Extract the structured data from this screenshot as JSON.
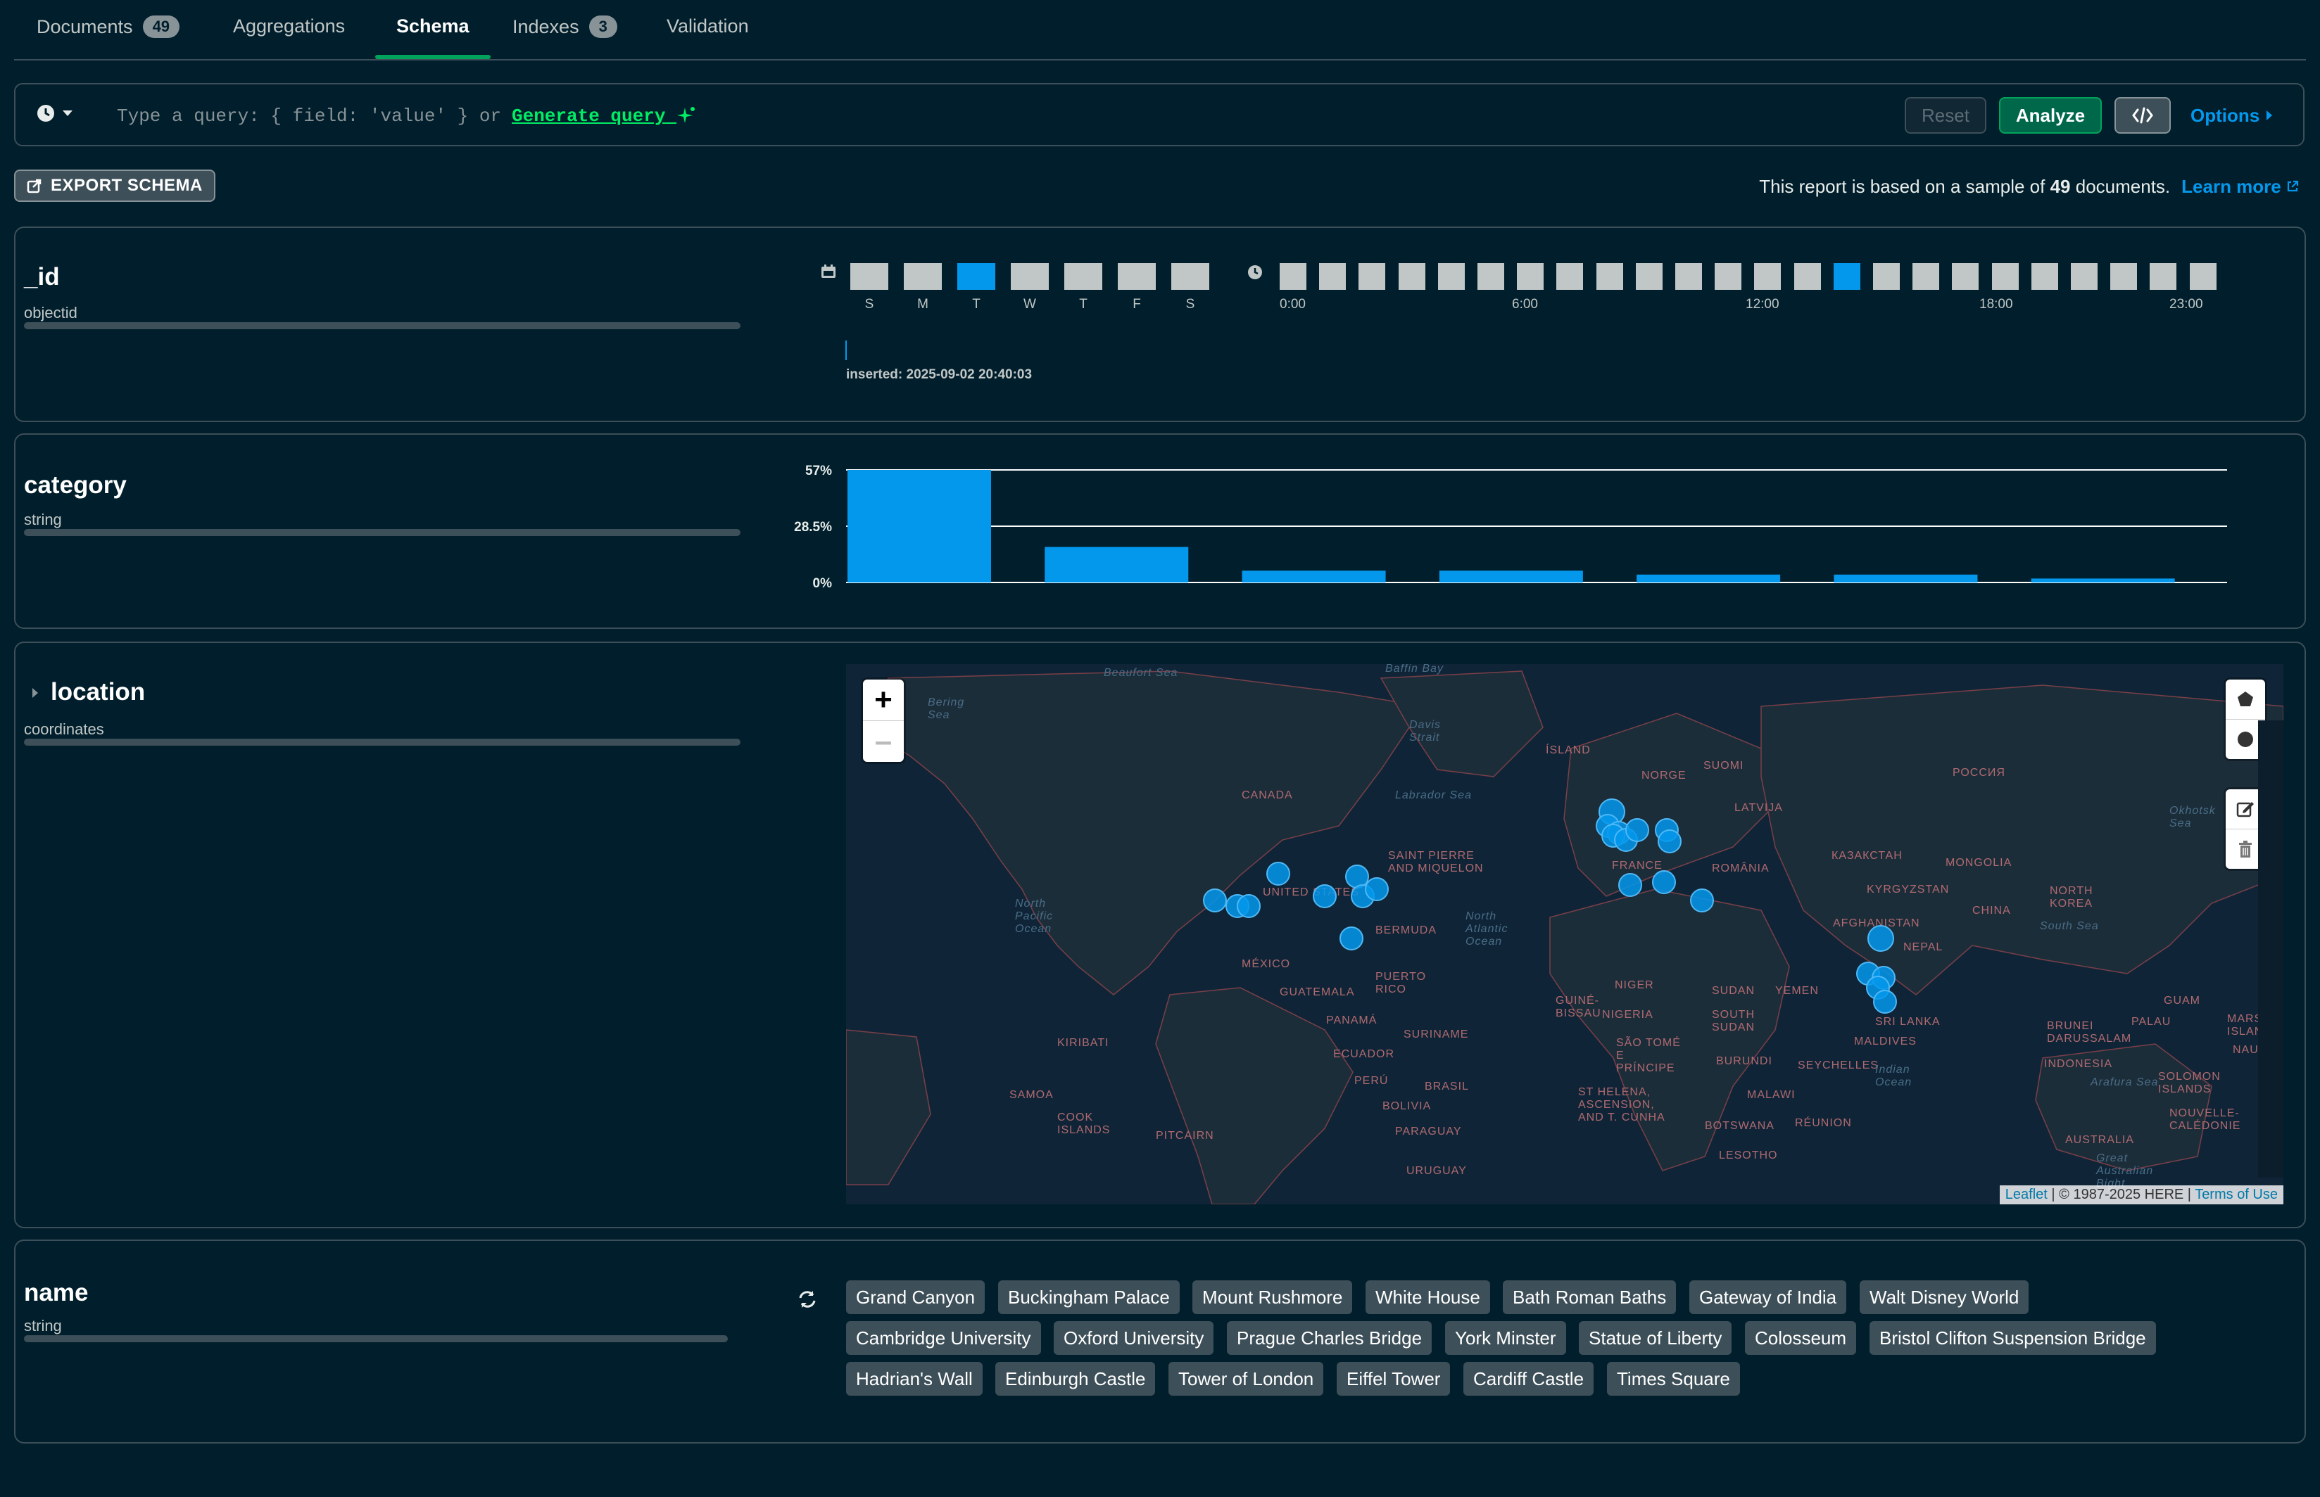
{
  "tabs": [
    {
      "label": "Documents",
      "badge": "49"
    },
    {
      "label": "Aggregations"
    },
    {
      "label": "Schema"
    },
    {
      "label": "Indexes",
      "badge": "3"
    },
    {
      "label": "Validation"
    }
  ],
  "query": {
    "placeholder_prefix": "Type a query: { field: 'value' } or",
    "generate_label": "Generate query",
    "reset_label": "Reset",
    "analyze_label": "Analyze",
    "options_label": "Options"
  },
  "export": {
    "label": "EXPORT SCHEMA"
  },
  "sample": {
    "prefix": "This report is based on a sample of",
    "count": "49",
    "suffix": "documents.",
    "learn_more": "Learn more"
  },
  "fields": {
    "id": {
      "name": "_id",
      "type": "objectid",
      "days": [
        "S",
        "M",
        "T",
        "W",
        "T",
        "F",
        "S"
      ],
      "highlight_day": 2,
      "hour_labels": [
        "0:00",
        "6:00",
        "12:00",
        "18:00",
        "23:00"
      ],
      "highlight_hour": 14,
      "inserted": "inserted: 2025-09-02 20:40:03"
    },
    "category": {
      "name": "category",
      "type": "string"
    },
    "location": {
      "name": "location",
      "type": "coordinates"
    },
    "name": {
      "name": "name",
      "type": "string"
    }
  },
  "chart_data": {
    "type": "bar",
    "values_percent": [
      57,
      18,
      6,
      6,
      4,
      4,
      2
    ],
    "ytick_labels": [
      "57%",
      "28.5%",
      "0%"
    ],
    "ylim": [
      0,
      57
    ]
  },
  "map": {
    "attribution_leaflet": "Leaflet",
    "attribution_rest": " | © 1987-2025 HERE | ",
    "attribution_terms": "Terms of Use",
    "labels": {
      "canada": "CANADA",
      "us": "UNITED STATES",
      "mexico": "MÉXICO",
      "guatemala": "GUATEMALA",
      "panama": "PANAMÁ",
      "ecuador": "ECUADOR",
      "peru": "PERÚ",
      "bolivia": "BOLIVIA",
      "brasil": "BRASIL",
      "paraguay": "PARAGUAY",
      "uruguay": "URUGUAY",
      "suriname": "SURINAME",
      "puerto": "PUERTO RICO",
      "bermuda": "BERMUDA",
      "stpierre": "SAINT PIERRE AND MIQUELON",
      "island": "ÍSLAND",
      "norge": "NORGE",
      "suomi": "SUOMI",
      "latvija": "LATVIJA",
      "russia": "РОССИЯ",
      "kazakh": "КАЗАКСТАН",
      "mongolia": "MONGOLIA",
      "china": "CHINA",
      "nkorea": "NORTH KOREA",
      "kyrgyz": "KYRGYZSTAN",
      "afghan": "AFGHANISTAN",
      "nepal": "NEPAL",
      "srilanka": "SRI LANKA",
      "maldives": "MALDIVES",
      "france": "FRANCE",
      "romania": "ROMÂNIA",
      "niger": "NIGER",
      "nigeria": "NIGERIA",
      "sudan": "SUDAN",
      "ssudan": "SOUTH SUDAN",
      "yemen": "YEMEN",
      "burundi": "BURUNDI",
      "malawi": "MALAWI",
      "botswana": "BOTSWANA",
      "lesotho": "LESOTHO",
      "reunion": "RÉUNION",
      "seychelles": "SEYCHELLES",
      "sthelena": "ST HELENA, ASCENSION, AND T. CUNHA",
      "saotome": "SÃO TOMÉ E PRÍNCIPE",
      "guinebissau": "GUINÉ-BISSAU",
      "indonesia": "INDONESIA",
      "brunei": "BRUNEI DARUSSALAM",
      "palau": "PALAU",
      "guam": "GUAM",
      "marshall": "MARSHALL ISLANDS",
      "nauru": "NAURU",
      "solomon": "SOLOMON ISLANDS",
      "caledonie": "NOUVELLE-CALÉDONIE",
      "australia": "AUSTRALIA",
      "kiribati": "KIRIBATI",
      "samoa": "SAMOA",
      "cook": "COOK ISLANDS",
      "pitcairn": "PITCAIRN",
      "npacific": "North Pacific Ocean",
      "natlantic": "North Atlantic Ocean",
      "indian": "Indian Ocean",
      "beaufort": "Beaufort Sea",
      "labrador": "Labrador Sea",
      "davis": "Davis Strait",
      "arafura": "Arafura Sea",
      "okhotsk": "Okhotsk Sea",
      "southsea": "South Sea",
      "baffin": "Baffin Bay",
      "bering": "Bering Sea",
      "greatbight": "Great Australian Bight"
    }
  },
  "names": [
    "Grand Canyon",
    "Buckingham Palace",
    "Mount Rushmore",
    "White House",
    "Bath Roman Baths",
    "Gateway of India",
    "Walt Disney World",
    "Cambridge University",
    "Oxford University",
    "Prague Charles Bridge",
    "York Minster",
    "Statue of Liberty",
    "Colosseum",
    "Bristol Clifton Suspension Bridge",
    "Hadrian's Wall",
    "Edinburgh Castle",
    "Tower of London",
    "Eiffel Tower",
    "Cardiff Castle",
    "Times Square"
  ]
}
